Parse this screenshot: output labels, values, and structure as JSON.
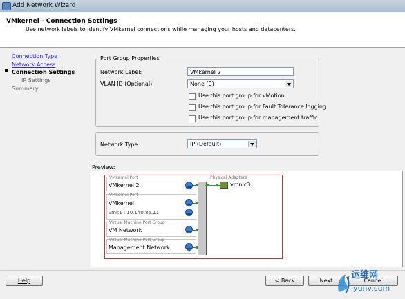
{
  "window": {
    "title": "Add Network Wizard"
  },
  "header": {
    "title": "VMkernel - Connection Settings",
    "subtitle": "Use network labels to identify VMkernel connections while managing your hosts and datacenters."
  },
  "nav": {
    "items": [
      {
        "label": "Connection Type",
        "state": "link"
      },
      {
        "label": "Network Access",
        "state": "link"
      },
      {
        "label": "Connection Settings",
        "state": "active"
      },
      {
        "label": "IP Settings",
        "state": "sub"
      },
      {
        "label": "Summary",
        "state": "pending"
      }
    ]
  },
  "port_group": {
    "legend": "Port Group Properties",
    "network_label_label": "Network Label:",
    "network_label_value": "VMkernel 2",
    "vlan_label": "VLAN ID (Optional):",
    "vlan_value": "None (0)",
    "options": [
      {
        "label": "Use this port group for vMotion",
        "checked": false
      },
      {
        "label": "Use this port group for Fault Tolerance logging",
        "checked": false
      },
      {
        "label": "Use this port group for management traffic",
        "checked": false
      }
    ]
  },
  "network_type": {
    "label": "Network Type:",
    "value": "IP (Default)"
  },
  "preview": {
    "label": "Preview:",
    "ports": [
      {
        "caption": "VMkernel Port",
        "name": "VMkernel 2",
        "detail": ""
      },
      {
        "caption": "VMkernel Port",
        "name": "VMkernel",
        "detail": "vmk1 : 10.140.86.11"
      },
      {
        "caption": "Virtual Machine Port Group",
        "name": "VM Network",
        "detail": ""
      },
      {
        "caption": "Virtual Machine Port Group",
        "name": "Management Network",
        "detail": ""
      }
    ],
    "adapters_caption": "Physical Adapters",
    "adapter": "vmnic3"
  },
  "buttons": {
    "help": "Help",
    "back": "< Back",
    "next": "Next",
    "cancel": "Cancel"
  },
  "watermark": {
    "line1": "运维网",
    "line2": "iyunv.com"
  },
  "colors": {
    "accent_red": "#d03030",
    "link": "#2a2ae0",
    "switch_green": "#2a9a2a"
  }
}
